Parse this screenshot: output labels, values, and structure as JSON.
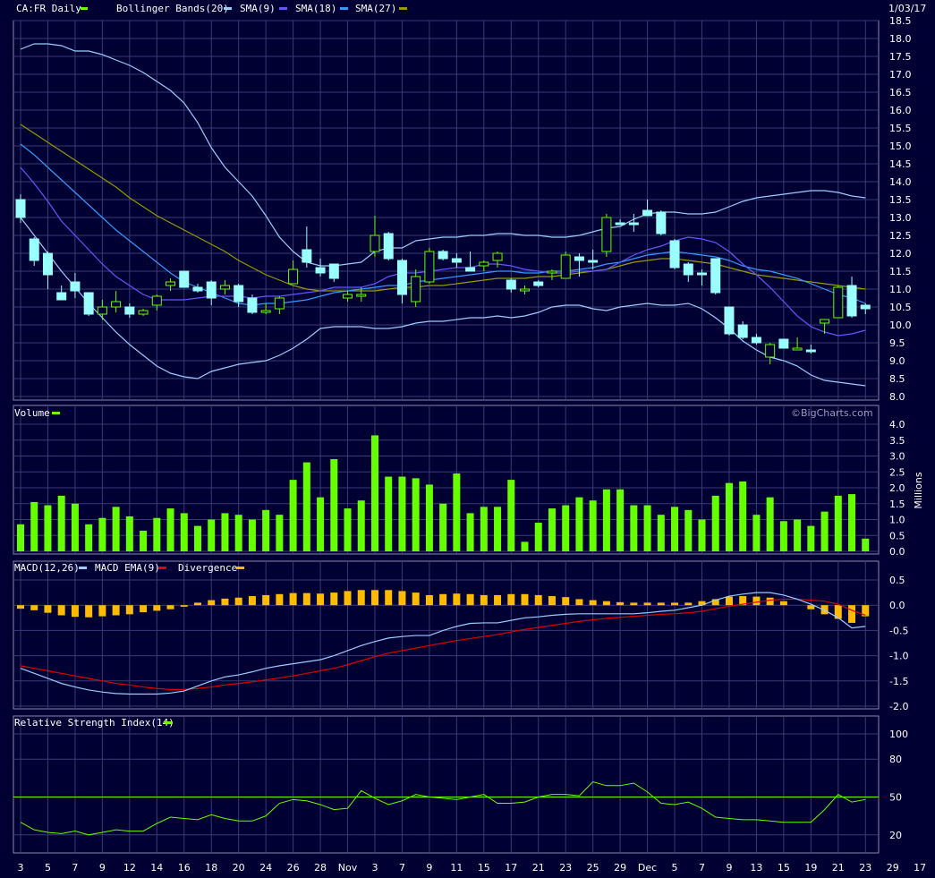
{
  "header": {
    "symbol_label": "CA:FR Daily",
    "overlay_labels": [
      "Bollinger Bands(20)",
      "SMA(9)",
      "SMA(18)",
      "SMA(27)"
    ],
    "date_label": "1/03/17"
  },
  "volume_panel": {
    "label": "Volume",
    "unit_label": "Millions",
    "watermark": "©BigCharts.com"
  },
  "macd_panel": {
    "labels": [
      "MACD(12,26)",
      "MACD EMA(9)",
      "Divergence"
    ]
  },
  "rsi_panel": {
    "label": "Relative Strength Index(14)"
  },
  "colors": {
    "background": "#000033",
    "grid": "#3a3a78",
    "up": "#66ff00",
    "down": "#99ffff",
    "bollinger": "#99ccff",
    "sma9": "#6655ff",
    "sma18": "#3399ff",
    "sma27": "#999900",
    "volume": "#66ff00",
    "macd": "#99ccff",
    "macd_ema": "#dd0000",
    "divergence": "#ffbb00",
    "rsi": "#66ff00"
  },
  "chart_data": [
    {
      "type": "candlestick",
      "title": "CA:FR Daily",
      "ylim": [
        8.0,
        18.5
      ],
      "y_ticks": [
        18.5,
        18.0,
        17.5,
        17.0,
        16.5,
        16.0,
        15.5,
        15.0,
        14.5,
        14.0,
        13.5,
        13.0,
        12.5,
        12.0,
        11.5,
        11.0,
        10.5,
        10.0,
        9.5,
        9.0,
        8.5,
        8.0
      ],
      "x_tick_labels": [
        "3",
        "5",
        "7",
        "9",
        "12",
        "14",
        "16",
        "18",
        "20",
        "24",
        "26",
        "28",
        "Nov",
        "3",
        "7",
        "9",
        "11",
        "15",
        "17",
        "21",
        "23",
        "25",
        "29",
        "Dec",
        "5",
        "7",
        "9",
        "13",
        "15",
        "19",
        "21",
        "23",
        "29",
        "17"
      ],
      "candles": [
        {
          "o": 13.5,
          "h": 13.65,
          "l": 12.85,
          "c": 13.0
        },
        {
          "o": 12.4,
          "h": 12.45,
          "l": 11.65,
          "c": 11.8
        },
        {
          "o": 12.0,
          "h": 12.05,
          "l": 11.0,
          "c": 11.4
        },
        {
          "o": 10.9,
          "h": 11.1,
          "l": 10.7,
          "c": 10.7
        },
        {
          "o": 11.2,
          "h": 11.45,
          "l": 10.75,
          "c": 10.95
        },
        {
          "o": 10.9,
          "h": 10.9,
          "l": 10.25,
          "c": 10.3
        },
        {
          "o": 10.3,
          "h": 10.7,
          "l": 10.15,
          "c": 10.5
        },
        {
          "o": 10.5,
          "h": 10.95,
          "l": 10.35,
          "c": 10.65
        },
        {
          "o": 10.5,
          "h": 10.6,
          "l": 10.2,
          "c": 10.3
        },
        {
          "o": 10.3,
          "h": 10.45,
          "l": 10.25,
          "c": 10.4
        },
        {
          "o": 10.55,
          "h": 10.85,
          "l": 10.4,
          "c": 10.8
        },
        {
          "o": 11.1,
          "h": 11.3,
          "l": 10.95,
          "c": 11.2
        },
        {
          "o": 11.5,
          "h": 11.5,
          "l": 11.05,
          "c": 11.05
        },
        {
          "o": 11.05,
          "h": 11.15,
          "l": 10.9,
          "c": 10.95
        },
        {
          "o": 11.2,
          "h": 11.25,
          "l": 10.55,
          "c": 10.75
        },
        {
          "o": 11.0,
          "h": 11.25,
          "l": 10.85,
          "c": 11.1
        },
        {
          "o": 11.1,
          "h": 11.15,
          "l": 10.5,
          "c": 10.65
        },
        {
          "o": 10.75,
          "h": 10.85,
          "l": 10.3,
          "c": 10.35
        },
        {
          "o": 10.4,
          "h": 10.6,
          "l": 10.3,
          "c": 10.4
        },
        {
          "o": 10.45,
          "h": 10.8,
          "l": 10.3,
          "c": 10.75
        },
        {
          "o": 11.15,
          "h": 11.8,
          "l": 11.15,
          "c": 11.55
        },
        {
          "o": 12.1,
          "h": 12.75,
          "l": 11.6,
          "c": 11.75
        },
        {
          "o": 11.6,
          "h": 11.85,
          "l": 11.35,
          "c": 11.45
        },
        {
          "o": 11.7,
          "h": 11.7,
          "l": 11.2,
          "c": 11.3
        },
        {
          "o": 10.75,
          "h": 10.95,
          "l": 10.65,
          "c": 10.85
        },
        {
          "o": 10.8,
          "h": 11.05,
          "l": 10.65,
          "c": 10.85
        },
        {
          "o": 12.05,
          "h": 13.05,
          "l": 11.9,
          "c": 12.5
        },
        {
          "o": 12.55,
          "h": 12.6,
          "l": 11.8,
          "c": 11.85
        },
        {
          "o": 11.8,
          "h": 11.85,
          "l": 10.6,
          "c": 10.85
        },
        {
          "o": 10.65,
          "h": 11.55,
          "l": 10.5,
          "c": 11.35
        },
        {
          "o": 11.2,
          "h": 12.15,
          "l": 11.15,
          "c": 12.05
        },
        {
          "o": 12.05,
          "h": 12.1,
          "l": 11.8,
          "c": 11.85
        },
        {
          "o": 11.85,
          "h": 12.0,
          "l": 11.6,
          "c": 11.75
        },
        {
          "o": 11.6,
          "h": 12.05,
          "l": 11.5,
          "c": 11.5
        },
        {
          "o": 11.65,
          "h": 11.8,
          "l": 11.5,
          "c": 11.75
        },
        {
          "o": 11.8,
          "h": 12.05,
          "l": 11.6,
          "c": 12.0
        },
        {
          "o": 11.25,
          "h": 11.3,
          "l": 10.9,
          "c": 11.0
        },
        {
          "o": 10.95,
          "h": 11.1,
          "l": 10.85,
          "c": 11.0
        },
        {
          "o": 11.2,
          "h": 11.25,
          "l": 11.05,
          "c": 11.1
        },
        {
          "o": 11.45,
          "h": 11.55,
          "l": 11.25,
          "c": 11.5
        },
        {
          "o": 11.3,
          "h": 12.05,
          "l": 11.3,
          "c": 11.95
        },
        {
          "o": 11.9,
          "h": 12.0,
          "l": 11.35,
          "c": 11.8
        },
        {
          "o": 11.8,
          "h": 12.1,
          "l": 11.55,
          "c": 11.75
        },
        {
          "o": 12.05,
          "h": 13.1,
          "l": 11.9,
          "c": 13.0
        },
        {
          "o": 12.85,
          "h": 12.95,
          "l": 12.8,
          "c": 12.8
        },
        {
          "o": 12.85,
          "h": 13.1,
          "l": 12.6,
          "c": 12.8
        },
        {
          "o": 13.2,
          "h": 13.5,
          "l": 13.05,
          "c": 13.05
        },
        {
          "o": 13.15,
          "h": 13.2,
          "l": 12.5,
          "c": 12.55
        },
        {
          "o": 12.35,
          "h": 12.4,
          "l": 11.55,
          "c": 11.6
        },
        {
          "o": 11.7,
          "h": 11.75,
          "l": 11.2,
          "c": 11.4
        },
        {
          "o": 11.45,
          "h": 11.55,
          "l": 11.1,
          "c": 11.4
        },
        {
          "o": 11.85,
          "h": 11.85,
          "l": 10.85,
          "c": 10.9
        },
        {
          "o": 10.5,
          "h": 10.5,
          "l": 9.7,
          "c": 9.75
        },
        {
          "o": 10.0,
          "h": 10.1,
          "l": 9.6,
          "c": 9.65
        },
        {
          "o": 9.65,
          "h": 9.75,
          "l": 9.45,
          "c": 9.5
        },
        {
          "o": 9.1,
          "h": 9.5,
          "l": 8.9,
          "c": 9.45
        },
        {
          "o": 9.6,
          "h": 9.6,
          "l": 9.35,
          "c": 9.35
        },
        {
          "o": 9.3,
          "h": 9.65,
          "l": 9.3,
          "c": 9.35
        },
        {
          "o": 9.3,
          "h": 9.45,
          "l": 9.2,
          "c": 9.25
        },
        {
          "o": 10.05,
          "h": 10.15,
          "l": 9.75,
          "c": 10.15
        },
        {
          "o": 10.2,
          "h": 11.1,
          "l": 10.2,
          "c": 11.05
        },
        {
          "o": 11.1,
          "h": 11.35,
          "l": 10.2,
          "c": 10.25
        },
        {
          "o": 10.55,
          "h": 10.6,
          "l": 10.3,
          "c": 10.45
        }
      ],
      "bollinger_upper": [
        17.7,
        17.85,
        17.85,
        17.8,
        17.65,
        17.65,
        17.55,
        17.4,
        17.25,
        17.05,
        16.8,
        16.55,
        16.2,
        15.65,
        14.95,
        14.4,
        14.0,
        13.6,
        13.05,
        12.45,
        12.05,
        11.75,
        11.65,
        11.65,
        11.7,
        11.75,
        12.05,
        12.15,
        12.15,
        12.35,
        12.4,
        12.45,
        12.45,
        12.5,
        12.5,
        12.55,
        12.55,
        12.5,
        12.5,
        12.45,
        12.45,
        12.5,
        12.6,
        12.7,
        12.75,
        12.95,
        13.1,
        13.15,
        13.15,
        13.1,
        13.1,
        13.15,
        13.3,
        13.45,
        13.55,
        13.6,
        13.65,
        13.7,
        13.75,
        13.75,
        13.7,
        13.6,
        13.55
      ],
      "bollinger_lower": [
        13.0,
        12.5,
        12.0,
        11.5,
        11.05,
        10.6,
        10.2,
        9.8,
        9.45,
        9.15,
        8.85,
        8.65,
        8.55,
        8.5,
        8.7,
        8.8,
        8.9,
        8.95,
        9.0,
        9.15,
        9.35,
        9.6,
        9.9,
        9.95,
        9.95,
        9.95,
        9.9,
        9.9,
        9.95,
        10.05,
        10.1,
        10.1,
        10.15,
        10.2,
        10.2,
        10.25,
        10.2,
        10.25,
        10.35,
        10.5,
        10.55,
        10.55,
        10.45,
        10.4,
        10.5,
        10.55,
        10.6,
        10.55,
        10.55,
        10.6,
        10.45,
        10.2,
        9.9,
        9.55,
        9.3,
        9.1,
        9.0,
        8.85,
        8.6,
        8.45,
        8.4,
        8.35,
        8.3
      ],
      "sma9": [
        14.4,
        13.95,
        13.45,
        12.9,
        12.5,
        12.1,
        11.7,
        11.35,
        11.1,
        10.85,
        10.7,
        10.7,
        10.7,
        10.75,
        10.8,
        10.8,
        10.8,
        10.75,
        10.8,
        10.8,
        10.85,
        10.9,
        10.95,
        11.05,
        11.05,
        11.05,
        11.15,
        11.35,
        11.45,
        11.45,
        11.5,
        11.55,
        11.6,
        11.6,
        11.7,
        11.7,
        11.65,
        11.55,
        11.5,
        11.45,
        11.45,
        11.5,
        11.5,
        11.55,
        11.75,
        11.95,
        12.1,
        12.2,
        12.35,
        12.45,
        12.4,
        12.3,
        12.05,
        11.7,
        11.4,
        11.05,
        10.65,
        10.25,
        9.95,
        9.8,
        9.7,
        9.75,
        9.85
      ],
      "sma18": [
        15.05,
        14.75,
        14.4,
        14.05,
        13.7,
        13.35,
        13.0,
        12.65,
        12.35,
        12.05,
        11.75,
        11.45,
        11.2,
        11.05,
        10.9,
        10.75,
        10.6,
        10.55,
        10.6,
        10.6,
        10.65,
        10.7,
        10.8,
        10.9,
        10.95,
        11.0,
        11.05,
        11.1,
        11.1,
        11.2,
        11.25,
        11.3,
        11.35,
        11.4,
        11.45,
        11.5,
        11.5,
        11.45,
        11.45,
        11.5,
        11.5,
        11.55,
        11.6,
        11.7,
        11.75,
        11.85,
        11.95,
        12.0,
        12.05,
        12.0,
        11.95,
        11.9,
        11.8,
        11.65,
        11.55,
        11.5,
        11.4,
        11.3,
        11.15,
        11.0,
        10.85,
        10.75,
        10.6
      ],
      "sma27": [
        15.6,
        15.35,
        15.1,
        14.85,
        14.6,
        14.35,
        14.1,
        13.85,
        13.55,
        13.3,
        13.05,
        12.85,
        12.65,
        12.45,
        12.25,
        12.05,
        11.8,
        11.6,
        11.4,
        11.25,
        11.1,
        11.0,
        10.95,
        10.95,
        10.95,
        10.95,
        10.95,
        11.0,
        11.05,
        11.05,
        11.1,
        11.1,
        11.15,
        11.2,
        11.25,
        11.3,
        11.3,
        11.3,
        11.35,
        11.35,
        11.4,
        11.45,
        11.5,
        11.55,
        11.65,
        11.75,
        11.8,
        11.85,
        11.85,
        11.8,
        11.75,
        11.7,
        11.6,
        11.5,
        11.4,
        11.35,
        11.3,
        11.25,
        11.2,
        11.15,
        11.1,
        11.05,
        11.0
      ]
    },
    {
      "type": "bar",
      "title": "Volume",
      "ylabel": "Millions",
      "ylim": [
        0,
        4.0
      ],
      "y_ticks": [
        4.0,
        3.5,
        3.0,
        2.5,
        2.0,
        1.5,
        1.0,
        0.5,
        0.0
      ],
      "values": [
        0.85,
        1.55,
        1.45,
        1.75,
        1.5,
        0.85,
        1.05,
        1.4,
        1.1,
        0.65,
        1.05,
        1.35,
        1.2,
        0.8,
        1.0,
        1.2,
        1.15,
        1.0,
        1.3,
        1.15,
        2.25,
        2.8,
        1.7,
        2.9,
        1.35,
        1.6,
        3.65,
        2.35,
        2.35,
        2.3,
        2.1,
        1.5,
        2.45,
        1.2,
        1.4,
        1.4,
        2.25,
        0.3,
        0.9,
        1.35,
        1.45,
        1.7,
        1.6,
        1.95,
        1.95,
        1.45,
        1.45,
        1.15,
        1.4,
        1.3,
        1.0,
        1.75,
        2.15,
        2.2,
        1.15,
        1.7,
        0.95,
        1.0,
        0.8,
        1.25,
        1.75,
        1.8,
        0.4
      ]
    },
    {
      "type": "line",
      "title": "MACD(12,26)",
      "ylim": [
        -2.0,
        0.5
      ],
      "y_ticks": [
        0.5,
        0.0,
        -0.5,
        -1.0,
        -1.5,
        -2.0
      ],
      "series": [
        {
          "name": "MACD(12,26)",
          "values": [
            -1.25,
            -1.35,
            -1.45,
            -1.55,
            -1.62,
            -1.68,
            -1.72,
            -1.75,
            -1.76,
            -1.76,
            -1.76,
            -1.74,
            -1.7,
            -1.6,
            -1.5,
            -1.42,
            -1.38,
            -1.32,
            -1.25,
            -1.2,
            -1.16,
            -1.12,
            -1.08,
            -1.0,
            -0.9,
            -0.8,
            -0.72,
            -0.65,
            -0.62,
            -0.6,
            -0.6,
            -0.5,
            -0.42,
            -0.36,
            -0.35,
            -0.35,
            -0.3,
            -0.25,
            -0.23,
            -0.2,
            -0.18,
            -0.17,
            -0.17,
            -0.17,
            -0.17,
            -0.17,
            -0.15,
            -0.12,
            -0.1,
            -0.05,
            0.0,
            0.1,
            0.18,
            0.22,
            0.25,
            0.25,
            0.2,
            0.12,
            0.02,
            -0.1,
            -0.25,
            -0.45,
            -0.42
          ]
        },
        {
          "name": "MACD EMA(9)",
          "values": [
            -1.2,
            -1.25,
            -1.3,
            -1.35,
            -1.4,
            -1.45,
            -1.5,
            -1.55,
            -1.58,
            -1.62,
            -1.65,
            -1.67,
            -1.67,
            -1.65,
            -1.62,
            -1.58,
            -1.55,
            -1.52,
            -1.48,
            -1.44,
            -1.4,
            -1.35,
            -1.3,
            -1.25,
            -1.18,
            -1.1,
            -1.02,
            -0.95,
            -0.9,
            -0.85,
            -0.8,
            -0.75,
            -0.7,
            -0.66,
            -0.62,
            -0.58,
            -0.53,
            -0.48,
            -0.44,
            -0.4,
            -0.36,
            -0.32,
            -0.29,
            -0.26,
            -0.24,
            -0.22,
            -0.2,
            -0.18,
            -0.17,
            -0.15,
            -0.12,
            -0.07,
            -0.02,
            0.02,
            0.06,
            0.1,
            0.12,
            0.12,
            0.1,
            0.08,
            0.02,
            -0.1,
            -0.2
          ]
        },
        {
          "name": "Divergence",
          "values": [
            -0.07,
            -0.1,
            -0.15,
            -0.2,
            -0.23,
            -0.24,
            -0.22,
            -0.2,
            -0.18,
            -0.14,
            -0.11,
            -0.08,
            -0.03,
            0.05,
            0.1,
            0.13,
            0.15,
            0.18,
            0.2,
            0.22,
            0.24,
            0.24,
            0.23,
            0.25,
            0.28,
            0.3,
            0.3,
            0.3,
            0.28,
            0.25,
            0.2,
            0.22,
            0.23,
            0.22,
            0.2,
            0.2,
            0.22,
            0.22,
            0.2,
            0.18,
            0.16,
            0.12,
            0.1,
            0.08,
            0.06,
            0.05,
            0.05,
            0.05,
            0.05,
            0.05,
            0.08,
            0.12,
            0.17,
            0.18,
            0.17,
            0.15,
            0.08,
            0.0,
            -0.08,
            -0.18,
            -0.27,
            -0.35,
            -0.22
          ]
        }
      ]
    },
    {
      "type": "line",
      "title": "Relative Strength Index(14)",
      "ylim": [
        0,
        100
      ],
      "y_ticks": [
        100,
        80,
        50,
        20,
        0
      ],
      "reference_line": 50,
      "series": [
        {
          "name": "Relative Strength Index(14)",
          "values": [
            30,
            24,
            22,
            21,
            23,
            20,
            22,
            24,
            23,
            23,
            29,
            34,
            33,
            32,
            36,
            33,
            31,
            31,
            35,
            45,
            48,
            47,
            44,
            40,
            41,
            55,
            49,
            44,
            47,
            52,
            50,
            49,
            48,
            50,
            52,
            45,
            45,
            46,
            50,
            52,
            52,
            51,
            62,
            59,
            59,
            61,
            54,
            45,
            44,
            46,
            41,
            34,
            33,
            32,
            32,
            31,
            30,
            30,
            30,
            40,
            52,
            46,
            48
          ]
        }
      ]
    }
  ]
}
